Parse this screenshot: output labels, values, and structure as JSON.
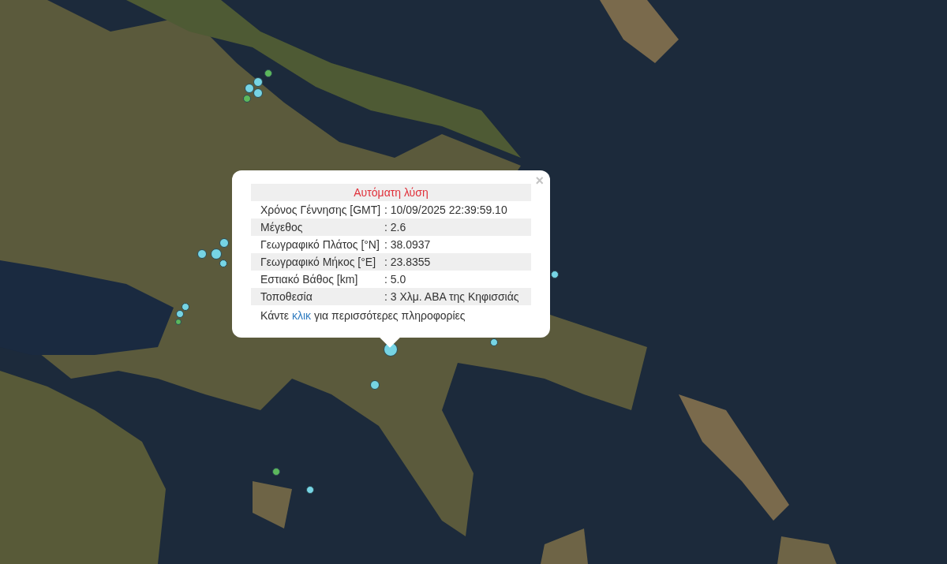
{
  "markers": [
    {
      "color": "#5cb85c"
    },
    {
      "color": "#76d4e4"
    },
    {
      "color": "#76d4e4"
    },
    {
      "color": "#5cb85c"
    },
    {
      "color": "#76d4e4"
    },
    {
      "color": "#76d4e4"
    },
    {
      "color": "#76d4e4"
    },
    {
      "color": "#76d4e4"
    },
    {
      "color": "#76d4e4"
    },
    {
      "color": "#5cb85c"
    },
    {
      "color": "#76d4e4"
    },
    {
      "color": "#76d4e4"
    },
    {
      "color": "#76d4e4"
    },
    {
      "color": "#76d4e4"
    },
    {
      "color": "#76d4e4"
    },
    {
      "color": "#5cb85c"
    },
    {
      "color": "#76d4e4"
    },
    {
      "color": "#76d4e4"
    }
  ],
  "popup": {
    "close": "×",
    "title": "Αυτόματη λύση",
    "rows": [
      {
        "label": "Χρόνος Γέννησης [GMT]",
        "value": ": 10/09/2025 22:39:59.10"
      },
      {
        "label": "Μέγεθος",
        "value": ": 2.6"
      },
      {
        "label": "Γεωγραφικό Πλάτος [°N]",
        "value": ": 38.0937"
      },
      {
        "label": "Γεωγραφικό Μήκος [°E]",
        "value": ": 23.8355"
      },
      {
        "label": "Εστιακό Βάθος [km]",
        "value": ": 5.0"
      },
      {
        "label": "Τοποθεσία",
        "value": ": 3 Χλμ. ΑΒΑ της Κηφισσιάς"
      }
    ],
    "hint": {
      "before": "Κάντε ",
      "link": "κλικ",
      "after": " για περισσότερες πληροφορίες"
    }
  }
}
